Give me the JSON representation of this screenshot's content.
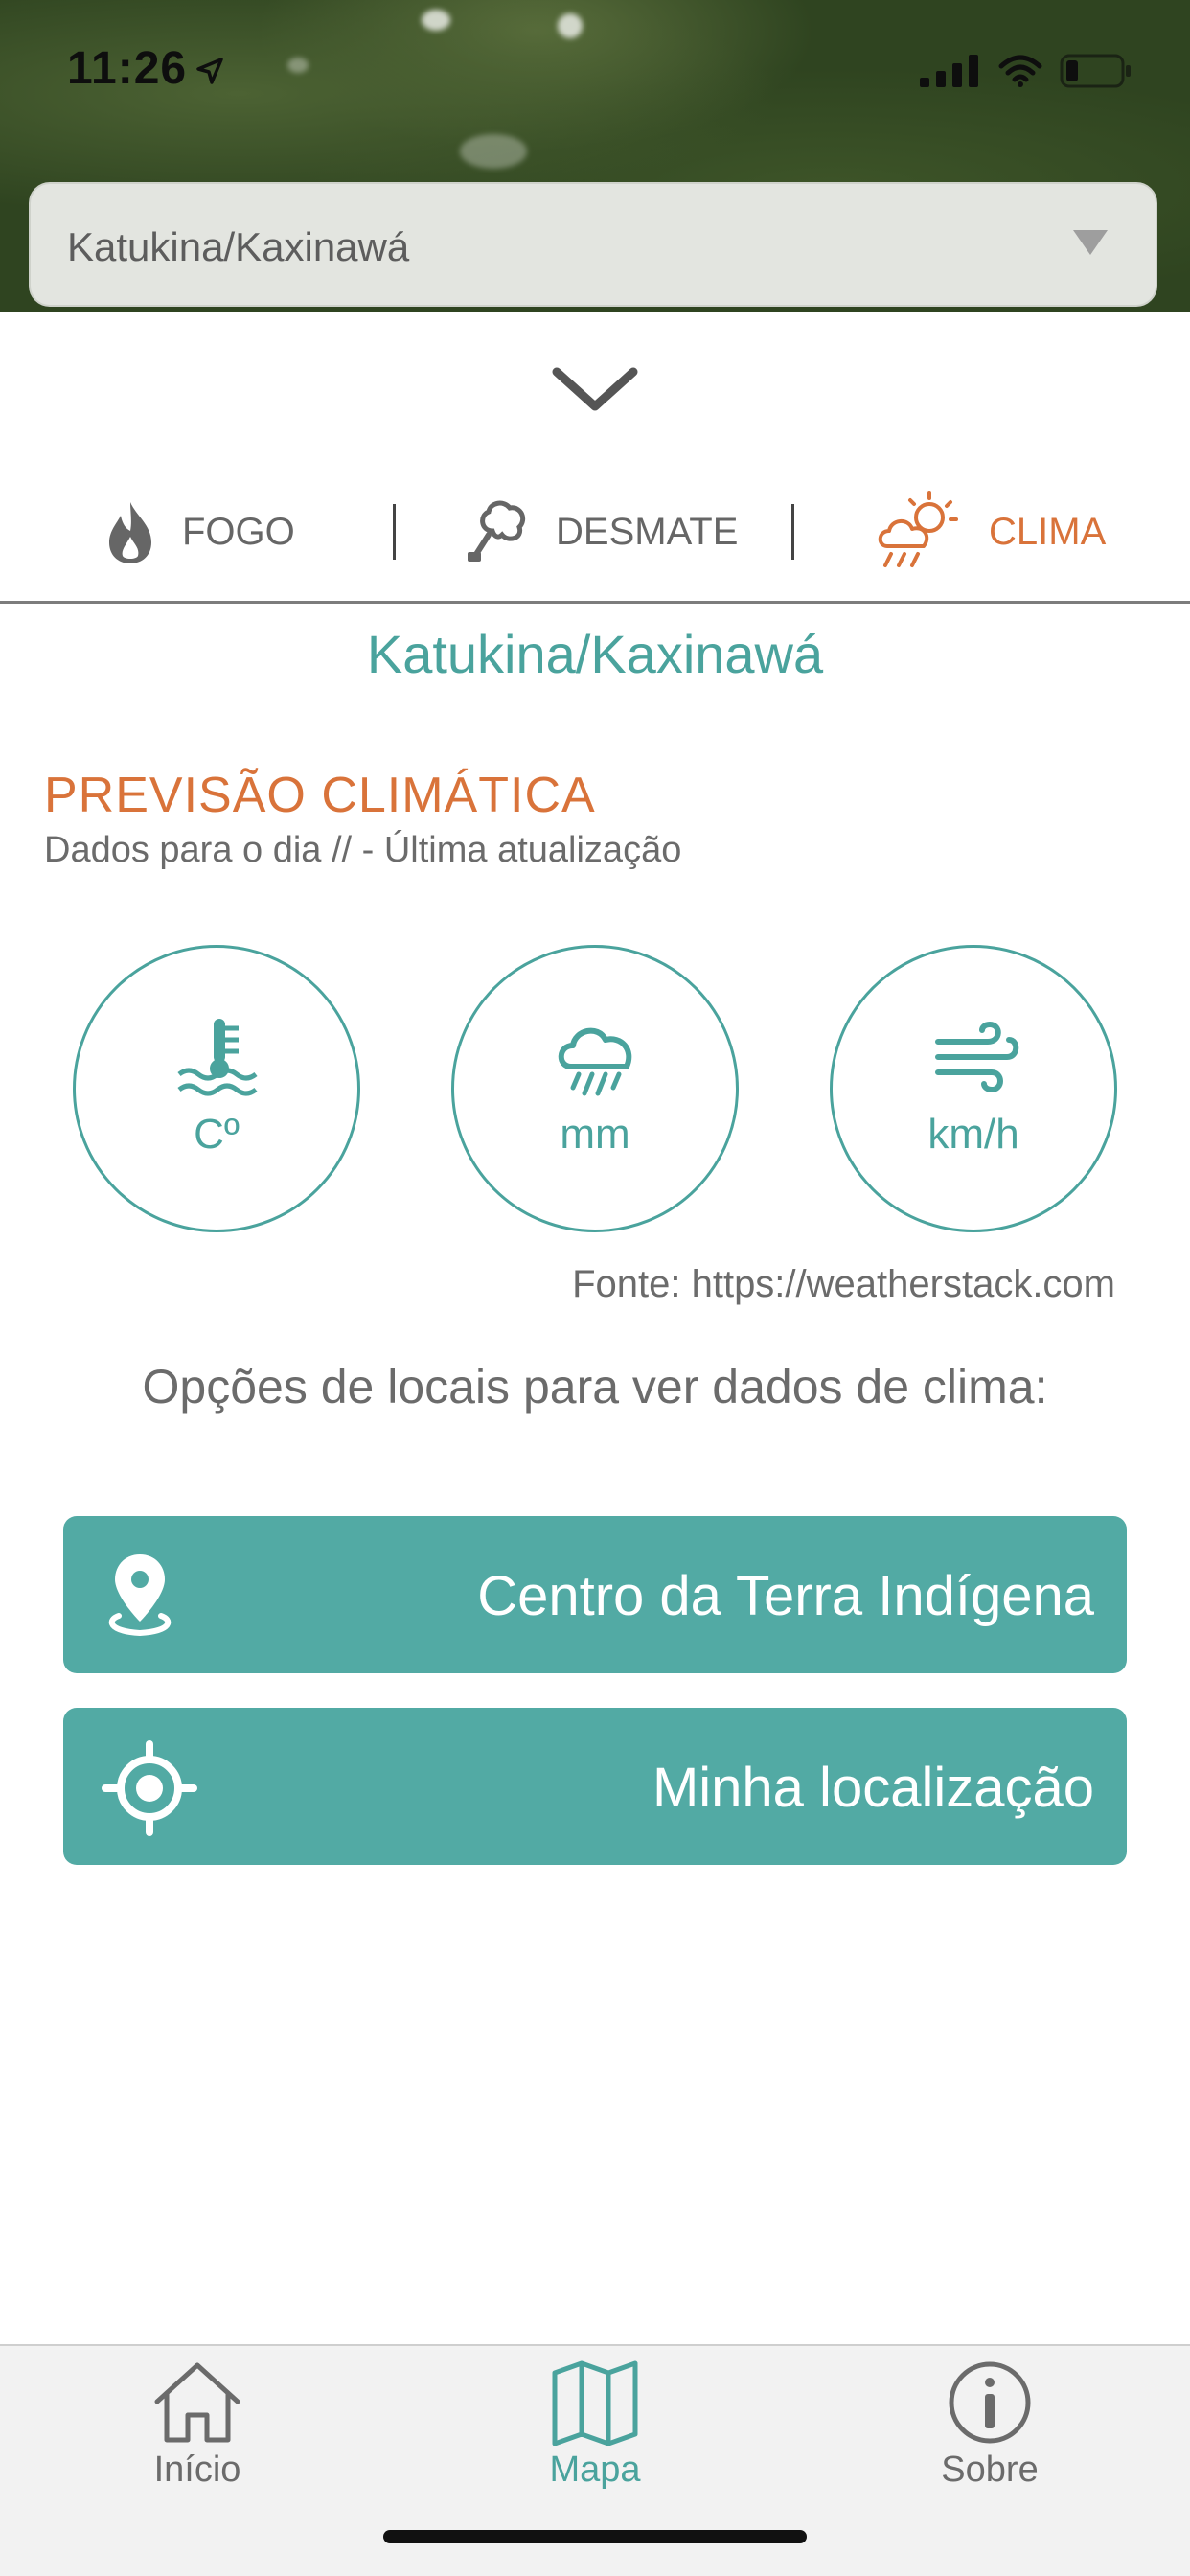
{
  "status_bar": {
    "time": "11:26"
  },
  "dropdown": {
    "value": "Katukina/Kaxinawá"
  },
  "tabs": [
    {
      "label": "FOGO",
      "icon": "fire-icon"
    },
    {
      "label": "DESMATE",
      "icon": "tree-icon"
    },
    {
      "label": "CLIMA",
      "icon": "cloud-sun-rain-icon",
      "active": true
    }
  ],
  "area_title": "Katukina/Kaxinawá",
  "forecast": {
    "title": "PREVISÃO CLIMÁTICA",
    "subtitle": "Dados para o dia // - Última atualização",
    "metrics": [
      {
        "icon": "thermometer-icon",
        "unit": "Cº"
      },
      {
        "icon": "rain-cloud-icon",
        "unit": "mm"
      },
      {
        "icon": "wind-icon",
        "unit": "km/h"
      }
    ],
    "source": "Fonte: https://weatherstack.com"
  },
  "options": {
    "label": "Opções de locais para ver dados de clima:",
    "buttons": [
      {
        "label": "Centro da Terra Indígena",
        "icon": "map-pin-icon"
      },
      {
        "label": "Minha localização",
        "icon": "crosshair-icon"
      }
    ]
  },
  "bottom_nav": [
    {
      "label": "Início",
      "icon": "home-icon"
    },
    {
      "label": "Mapa",
      "icon": "map-icon",
      "active": true
    },
    {
      "label": "Sobre",
      "icon": "info-icon"
    }
  ],
  "colors": {
    "teal": "#4aa39d",
    "button_teal": "#52aaa4",
    "orange": "#d9733a",
    "gray_text": "#6b6b6b"
  }
}
